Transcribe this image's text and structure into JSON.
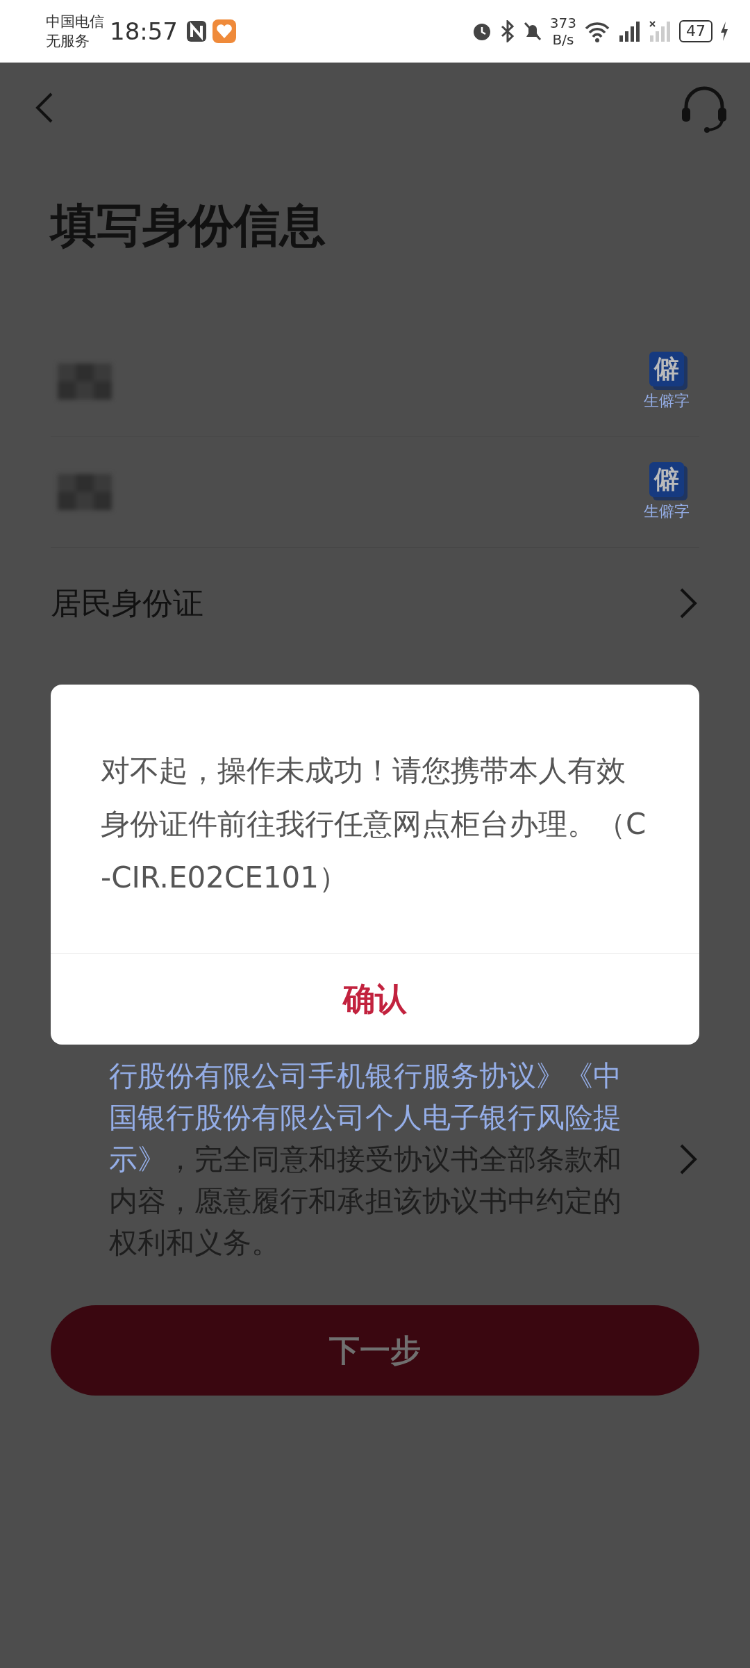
{
  "status_bar": {
    "carrier": "中国电信",
    "service": "无服务",
    "time": "18:57",
    "speed_value": "373",
    "speed_unit": "B/s",
    "battery": "47"
  },
  "title": "填写身份信息",
  "fields": [
    {
      "kind": "masked",
      "helper_glyph": "僻",
      "helper_label": "生僻字"
    },
    {
      "kind": "masked",
      "helper_glyph": "僻",
      "helper_label": "生僻字"
    },
    {
      "kind": "select",
      "value": "居民身份证"
    }
  ],
  "agreement": {
    "lines": [
      [
        {
          "kind": "link",
          "text": "行股份有限公司手机银行服务协议》"
        },
        {
          "kind": "link",
          "text": "《中"
        }
      ],
      [
        {
          "kind": "link",
          "text": "国银行股份有限公司个人电子银行风险提"
        }
      ],
      [
        {
          "kind": "link",
          "text": "示》"
        },
        {
          "kind": "text",
          "text": "，完全同意和接受协议书全部条款和"
        }
      ],
      [
        {
          "kind": "text",
          "text": "内容，愿意履行和承担该协议书中约定的"
        }
      ],
      [
        {
          "kind": "text",
          "text": "权利和义务。"
        }
      ]
    ]
  },
  "next_button": {
    "label": "下一步",
    "disabled": true
  },
  "dialog": {
    "message": "对不起，操作未成功！请您携带本人有效身份证件前往我行任意网点柜台办理。（C-CIR.E02CE101）",
    "confirm": "确认"
  }
}
